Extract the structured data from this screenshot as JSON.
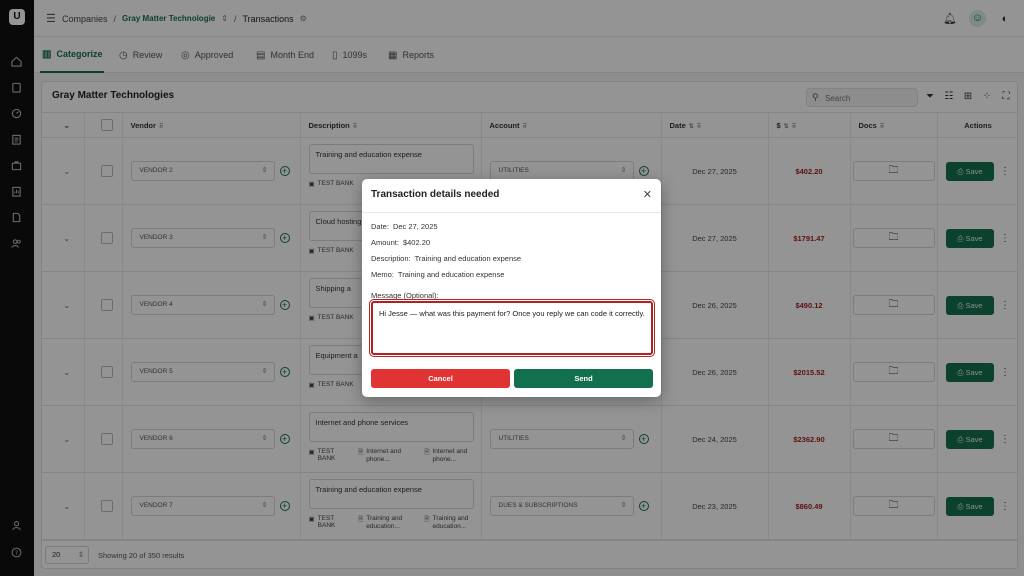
{
  "app": {
    "logo_text": "U"
  },
  "breadcrumb": {
    "root": "Companies",
    "company": "Gray Matter Technologie",
    "current": "Transactions"
  },
  "tabs": [
    {
      "label": "Categorize",
      "icon": "categorize-icon"
    },
    {
      "label": "Review",
      "icon": "review-icon"
    },
    {
      "label": "Approved",
      "icon": "approved-icon"
    },
    {
      "label": "Month End",
      "icon": "calendar-icon"
    },
    {
      "label": "1099s",
      "icon": "document-icon"
    },
    {
      "label": "Reports",
      "icon": "reports-icon"
    }
  ],
  "card": {
    "title": "Gray Matter Technologies"
  },
  "search": {
    "placeholder": "Search"
  },
  "columns": {
    "vendor": "Vendor",
    "description": "Description",
    "account": "Account",
    "date": "Date",
    "amount": "$",
    "docs": "Docs",
    "actions": "Actions"
  },
  "rows": [
    {
      "vendor": "VENDOR 2",
      "description": "Training and education expense",
      "bank": "TEST BANK",
      "account": "UTILITIES",
      "date": "Dec 27, 2025",
      "amount": "$402.20",
      "save": "Save"
    },
    {
      "vendor": "VENDOR 3",
      "description": "Cloud hosting",
      "bank": "TEST BANK",
      "account": "",
      "date": "Dec 27, 2025",
      "amount": "$1791.47",
      "save": "Save"
    },
    {
      "vendor": "VENDOR 4",
      "description": "Shipping a",
      "bank": "TEST BANK",
      "account": "",
      "date": "Dec 26, 2025",
      "amount": "$490.12",
      "save": "Save"
    },
    {
      "vendor": "VENDOR 5",
      "description": "Equipment a",
      "bank": "TEST BANK",
      "account": "",
      "date": "Dec 26, 2025",
      "amount": "$2015.52",
      "save": "Save"
    },
    {
      "vendor": "VENDOR 6",
      "description": "Internet and phone services",
      "bank": "TEST BANK",
      "attach1": "Internet and phone...",
      "attach2": "Internet and phone...",
      "account": "UTILITIES",
      "date": "Dec 24, 2025",
      "amount": "$2362.90",
      "save": "Save"
    },
    {
      "vendor": "VENDOR 7",
      "description": "Training and education expense",
      "bank": "TEST BANK",
      "attach1": "Training and education...",
      "attach2": "Training and education...",
      "account": "DUES & SUBSCRIPTIONS",
      "date": "Dec 23, 2025",
      "amount": "$860.49",
      "save": "Save"
    }
  ],
  "footer": {
    "per_page": "20",
    "results": "Showing 20 of 350 results"
  },
  "modal": {
    "title": "Transaction details needed",
    "date_label": "Date:",
    "date": "Dec 27, 2025",
    "amount_label": "Amount:",
    "amount": "$402.20",
    "description_label": "Description:",
    "description": "Training and education expense",
    "memo_label": "Memo:",
    "memo": "Training and education expense",
    "message_label": "Message (Optional):",
    "message": "Hi Jesse — what was this payment for? Once you reply we can code it correctly.",
    "cancel": "Cancel",
    "send": "Send"
  },
  "colors": {
    "brand": "#13704f",
    "danger": "#e03333",
    "amount": "#a31f1f"
  }
}
